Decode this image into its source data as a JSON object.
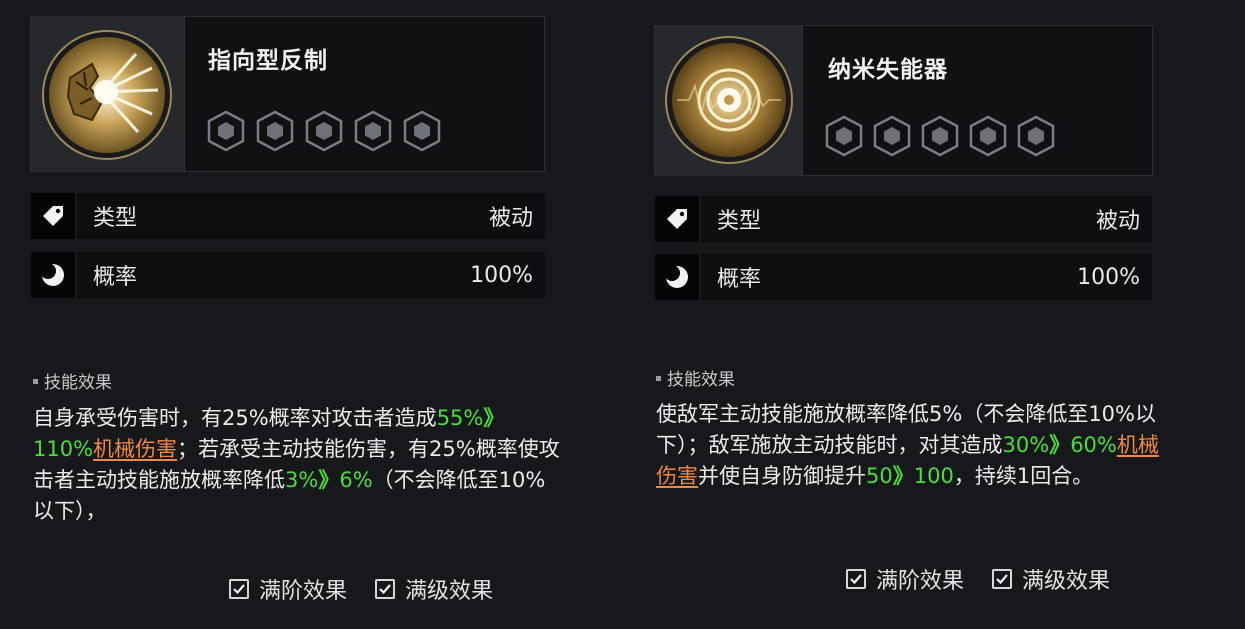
{
  "colors": {
    "highlight_green": "#4ade3a",
    "highlight_orange": "#f0883e",
    "background": "#17181b"
  },
  "cards": [
    {
      "title": "指向型反制",
      "icon": "cracked-shield-burst-icon",
      "hex_count": 5,
      "rows": [
        {
          "icon": "tag-icon",
          "label": "类型",
          "value": "被动"
        },
        {
          "icon": "moon-icon",
          "label": "概率",
          "value": "100%"
        }
      ],
      "section_title": "技能效果",
      "desc": {
        "p1": "自身承受伤害时，有25%概率对攻击者造成",
        "v1a": "55%",
        "arrow1": "》",
        "v1b": "110%",
        "dmg": "机械伤害",
        "p2": "；若承受主动技能伤害，有25%概率使攻击者主动技能施放概率降低",
        "v2a": "3%",
        "arrow2": "》",
        "v2b": "6%",
        "p3": "（不会降低至10%以下），"
      },
      "checks": [
        "满阶效果",
        "满级效果"
      ]
    },
    {
      "title": "纳米失能器",
      "icon": "nano-disruptor-icon",
      "hex_count": 5,
      "rows": [
        {
          "icon": "tag-icon",
          "label": "类型",
          "value": "被动"
        },
        {
          "icon": "moon-icon",
          "label": "概率",
          "value": "100%"
        }
      ],
      "section_title": "技能效果",
      "desc": {
        "p1": "使敌军主动技能施放概率降低5%（不会降低至10%以下）；敌军施放主动技能时，对其造成",
        "v1a": "30%",
        "arrow1": "》",
        "v1b": "60%",
        "dmg": "机械伤害",
        "p2": "并使自身防御提升",
        "v2a": "50",
        "arrow2": "》",
        "v2b": "100",
        "p3": "，持续1回合。"
      },
      "checks": [
        "满阶效果",
        "满级效果"
      ]
    }
  ]
}
